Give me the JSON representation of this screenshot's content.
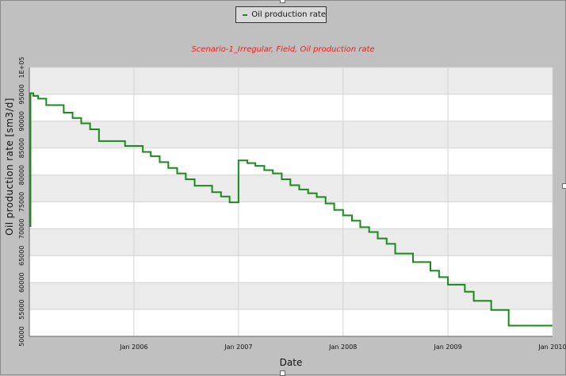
{
  "legend": {
    "label": "Oil production rate",
    "color": "#1a8a1a"
  },
  "chart_data": {
    "type": "line",
    "step": true,
    "title": "Scenario-1_Irregular, Field, Oil production rate",
    "title_color": "#e8201a",
    "xlabel": "Date",
    "ylabel": "Oil production rate [sm3/d]",
    "xlim": [
      "2005-01-01",
      "2010-01-01"
    ],
    "ylim": [
      50000,
      100000
    ],
    "x_ticks": [
      "2006-01-01",
      "2007-01-01",
      "2008-01-01",
      "2009-01-01",
      "2010-01-01"
    ],
    "x_tick_labels": [
      "Jan 2006",
      "Jan 2007",
      "Jan 2008",
      "Jan 2009",
      "Jan 2010"
    ],
    "y_ticks": [
      50000,
      55000,
      60000,
      65000,
      70000,
      75000,
      80000,
      85000,
      90000,
      95000,
      100000
    ],
    "y_tick_labels": [
      "50000",
      "55000",
      "60000",
      "65000",
      "70000",
      "75000",
      "80000",
      "85000",
      "90000",
      "95000",
      "1E+05"
    ],
    "grid": true,
    "legend_position": "top-center",
    "series": [
      {
        "name": "Oil production rate",
        "color": "#1a8a1a",
        "x": [
          "2005-01-01",
          "2005-01-05",
          "2005-01-15",
          "2005-02-01",
          "2005-03-01",
          "2005-05-01",
          "2005-06-01",
          "2005-07-01",
          "2005-08-01",
          "2005-09-01",
          "2005-10-01",
          "2005-11-01",
          "2005-12-01",
          "2006-01-01",
          "2006-02-01",
          "2006-03-01",
          "2006-04-01",
          "2006-05-01",
          "2006-06-01",
          "2006-07-01",
          "2006-08-01",
          "2006-09-01",
          "2006-10-01",
          "2006-11-01",
          "2006-12-01",
          "2007-01-01",
          "2007-02-01",
          "2007-03-01",
          "2007-04-01",
          "2007-05-01",
          "2007-06-01",
          "2007-07-01",
          "2007-08-01",
          "2007-09-01",
          "2007-10-01",
          "2007-11-01",
          "2007-12-01",
          "2008-01-01",
          "2008-02-01",
          "2008-03-01",
          "2008-04-01",
          "2008-05-01",
          "2008-06-01",
          "2008-07-01",
          "2008-08-01",
          "2008-09-01",
          "2008-10-01",
          "2008-11-01",
          "2008-12-01",
          "2009-01-01",
          "2009-02-01",
          "2009-03-01",
          "2009-04-01",
          "2009-05-01",
          "2009-06-01",
          "2009-07-01",
          "2009-08-01",
          "2009-09-01",
          "2009-10-01",
          "2009-11-01",
          "2009-12-01",
          "2010-01-01"
        ],
        "y": [
          70500,
          95200,
          94700,
          94200,
          93000,
          91600,
          90600,
          89600,
          88500,
          86300,
          86300,
          86300,
          85400,
          85400,
          84300,
          83500,
          82400,
          81300,
          80300,
          79200,
          78000,
          78000,
          76800,
          76000,
          74900,
          82700,
          82200,
          81700,
          80900,
          80300,
          79200,
          78100,
          77300,
          76600,
          75900,
          74700,
          73500,
          72500,
          71500,
          70300,
          69400,
          68200,
          67200,
          65400,
          65400,
          63800,
          63800,
          62200,
          61000,
          59600,
          59600,
          58300,
          56600,
          56600,
          54900,
          54900,
          52000,
          52000,
          52000,
          52000,
          52000,
          52000
        ]
      }
    ]
  }
}
